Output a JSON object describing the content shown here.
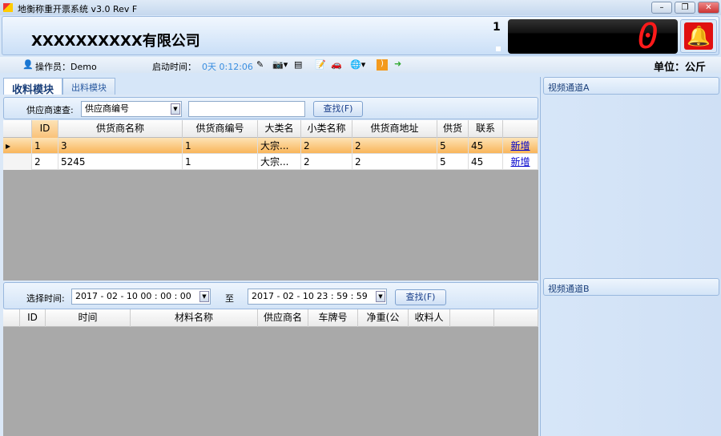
{
  "window": {
    "title": "地衡称重开票系统  v3.0 Rev F"
  },
  "header": {
    "company": "XXXXXXXXXX有限公司",
    "scale_number": "1",
    "display_value": "0",
    "unit_label": "单位：公斤"
  },
  "toolbar": {
    "operator": "操作员：Demo",
    "uptime_label": "启动时间：",
    "uptime_value": "0天 0:12:06"
  },
  "tabs": [
    {
      "label": "收料模块",
      "active": true
    },
    {
      "label": "出料模块",
      "active": false
    }
  ],
  "search": {
    "label": "供应商速查:",
    "field_value": "供应商编号",
    "query": "",
    "button": "查找(F)"
  },
  "supplier_grid": {
    "columns": [
      "ID",
      "供货商名称",
      "供货商编号",
      "大类名",
      "小类名称",
      "供货商地址",
      "供货",
      "联系",
      ""
    ],
    "rows": [
      [
        "1",
        "3",
        "1",
        "大宗...",
        "2",
        "2",
        "5",
        "45",
        "新增"
      ],
      [
        "2",
        "5245",
        "1",
        "大宗...",
        "2",
        "2",
        "5",
        "45",
        "新增"
      ]
    ]
  },
  "time_filter": {
    "label": "选择时间:",
    "start": "2017 - 02 - 10   00 : 00 : 00",
    "to": "至",
    "end": "2017 - 02 - 10   23 : 59 : 59",
    "button": "查找(F)"
  },
  "record_grid": {
    "columns": [
      "ID",
      "时间",
      "材料名称",
      "供应商名",
      "车牌号",
      "净重(公",
      "收料人",
      "",
      ""
    ]
  },
  "video": {
    "a": "视频通道A",
    "b": "视频通道B"
  },
  "colors": {
    "accent": "#f9b55a",
    "display_digit": "#ff1a1a",
    "alarm": "#e01010"
  }
}
